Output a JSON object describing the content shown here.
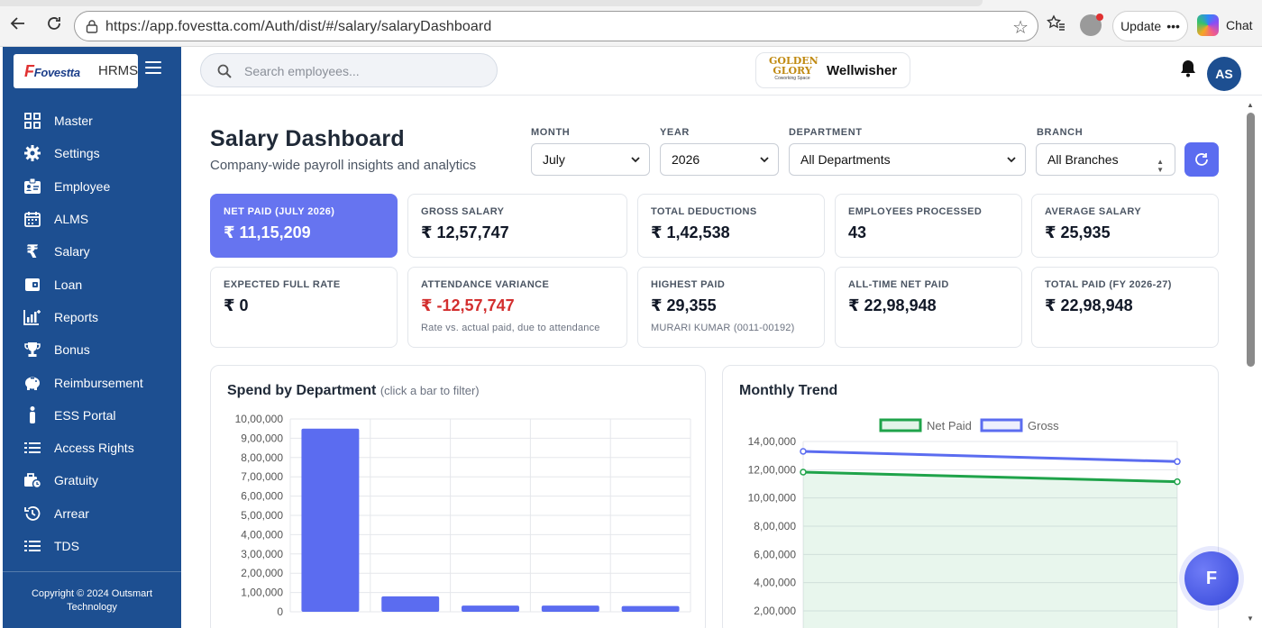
{
  "browser": {
    "url": "https://app.fovestta.com/Auth/dist/#/salary/salaryDashboard",
    "update_label": "Update",
    "chat_label": "Chat"
  },
  "sidebar": {
    "brand_logo": "Fovestta",
    "brand_suffix": "HRMS",
    "items": [
      {
        "label": "Master",
        "icon": "grid-icon"
      },
      {
        "label": "Settings",
        "icon": "gear-icon"
      },
      {
        "label": "Employee",
        "icon": "id-card-icon"
      },
      {
        "label": "ALMS",
        "icon": "calendar-icon"
      },
      {
        "label": "Salary",
        "icon": "rupee-icon"
      },
      {
        "label": "Loan",
        "icon": "wallet-icon"
      },
      {
        "label": "Reports",
        "icon": "chart-icon"
      },
      {
        "label": "Bonus",
        "icon": "trophy-icon"
      },
      {
        "label": "Reimbursement",
        "icon": "piggy-bank-icon"
      },
      {
        "label": "ESS Portal",
        "icon": "person-icon"
      },
      {
        "label": "Access Rights",
        "icon": "list-icon"
      },
      {
        "label": "Gratuity",
        "icon": "briefcase-icon"
      },
      {
        "label": "Arrear",
        "icon": "history-icon"
      },
      {
        "label": "TDS",
        "icon": "list-icon"
      }
    ],
    "copyright_line1": "Copyright © 2024 Outsmart",
    "copyright_line2": "Technology"
  },
  "header": {
    "search_placeholder": "Search employees...",
    "company_logo_line1": "GOLDEN",
    "company_logo_line2": "GLORY",
    "company_logo_tag": "Coworking Space",
    "company_name": "Wellwisher",
    "avatar_initials": "AS"
  },
  "dashboard": {
    "title": "Salary Dashboard",
    "subtitle": "Company-wide payroll insights and analytics",
    "filters": {
      "month_label": "MONTH",
      "month_value": "July",
      "year_label": "YEAR",
      "year_value": "2026",
      "department_label": "DEPARTMENT",
      "department_value": "All Departments",
      "branch_label": "BRANCH",
      "branch_value": "All Branches"
    },
    "cards": [
      {
        "label": "NET PAID (JULY 2026)",
        "value": "₹ 11,15,209"
      },
      {
        "label": "GROSS SALARY",
        "value": "₹ 12,57,747"
      },
      {
        "label": "TOTAL DEDUCTIONS",
        "value": "₹ 1,42,538"
      },
      {
        "label": "EMPLOYEES PROCESSED",
        "value": "43"
      },
      {
        "label": "AVERAGE SALARY",
        "value": "₹ 25,935"
      },
      {
        "label": "EXPECTED FULL RATE",
        "value": "₹ 0"
      },
      {
        "label": "ATTENDANCE VARIANCE",
        "value": "₹ -12,57,747",
        "note": "Rate vs. actual paid, due to attendance"
      },
      {
        "label": "HIGHEST PAID",
        "value": "₹ 29,355",
        "note": "MURARI KUMAR (0011-00192)"
      },
      {
        "label": "ALL-TIME NET PAID",
        "value": "₹ 22,98,948"
      },
      {
        "label": "TOTAL PAID (FY 2026-27)",
        "value": "₹ 22,98,948"
      }
    ],
    "dept_chart_title": "Spend by Department",
    "dept_chart_hint": "(click a bar to filter)",
    "trend_chart_title": "Monthly Trend",
    "fab_label": "F"
  },
  "colors": {
    "sidebar": "#1d4f91",
    "accent": "#5b6cf0",
    "net_paid_line": "#1fa34a",
    "gross_line": "#5b6cf0",
    "negative": "#d32f2f"
  },
  "chart_data": [
    {
      "type": "bar",
      "title": "Spend by Department",
      "categories": [
        "",
        "",
        "",
        "",
        ""
      ],
      "values": [
        950000,
        80000,
        32000,
        32000,
        30000
      ],
      "ylim": [
        0,
        1000000
      ],
      "yticks": [
        "0",
        "1,00,000",
        "2,00,000",
        "3,00,000",
        "4,00,000",
        "5,00,000",
        "6,00,000",
        "7,00,000",
        "8,00,000",
        "9,00,000",
        "10,00,000"
      ],
      "grid": true,
      "color": "#5b6cf0"
    },
    {
      "type": "line",
      "title": "Monthly Trend",
      "x": [
        "",
        ""
      ],
      "series": [
        {
          "name": "Net Paid",
          "values": [
            1183000,
            1115209
          ],
          "color": "#1fa34a",
          "fill": true
        },
        {
          "name": "Gross",
          "values": [
            1330000,
            1257747
          ],
          "color": "#5b6cf0",
          "fill": false
        }
      ],
      "ylim": [
        200000,
        1400000
      ],
      "yticks": [
        "2,00,000",
        "4,00,000",
        "6,00,000",
        "8,00,000",
        "10,00,000",
        "12,00,000",
        "14,00,000"
      ],
      "legend": "top-center",
      "grid": true
    }
  ]
}
